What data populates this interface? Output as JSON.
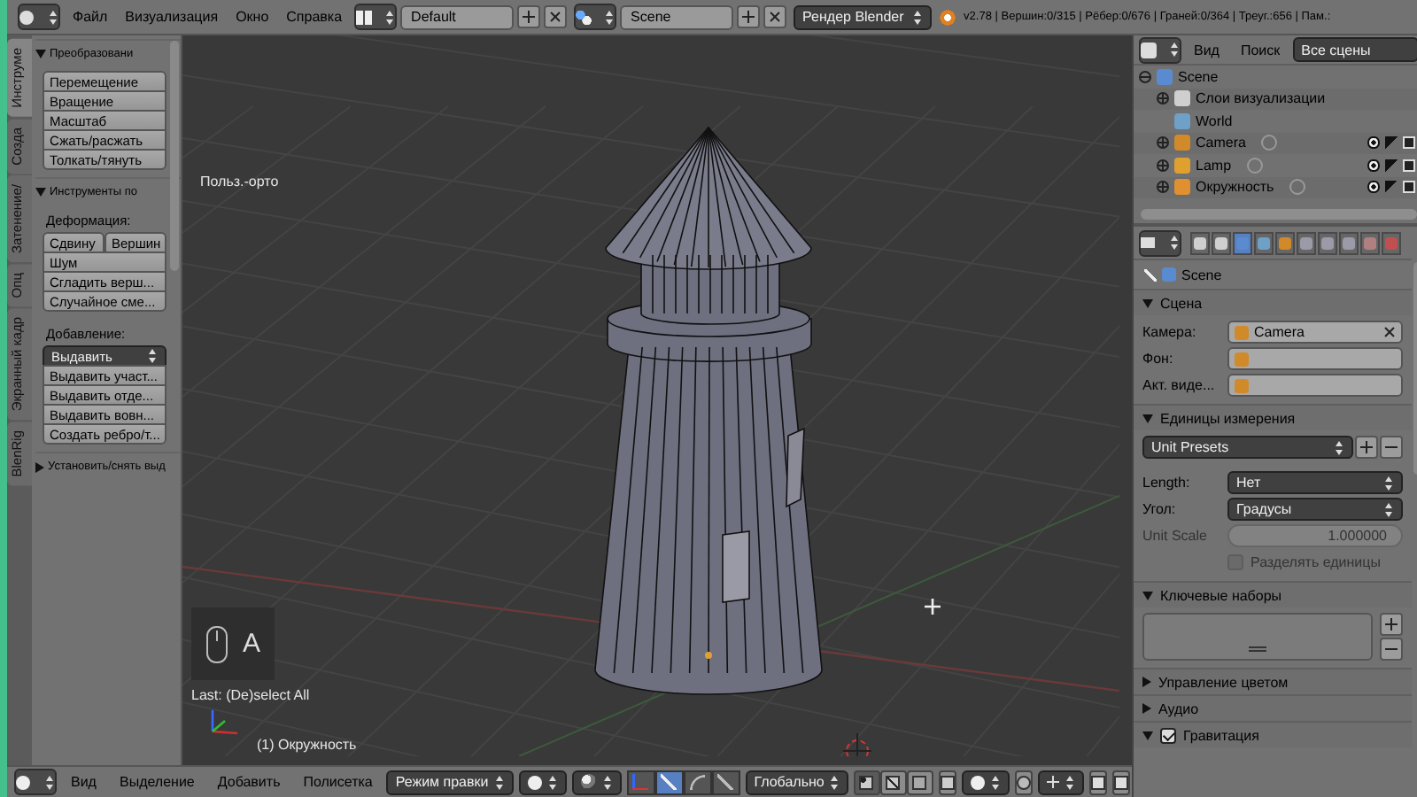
{
  "header": {
    "menus": [
      "Файл",
      "Визуализация",
      "Окно",
      "Справка"
    ],
    "layout": "Default",
    "scene": "Scene",
    "engine": "Рендер Blender",
    "stats": "v2.78 | Вершин:0/315 | Рёбер:0/676 | Граней:0/364 | Треуг.:656 | Пам.:"
  },
  "tool_tabs": [
    {
      "label": "Инструме",
      "selected": true
    },
    {
      "label": "Созда",
      "selected": false
    },
    {
      "label": "Затенение/",
      "selected": false
    },
    {
      "label": "Опц",
      "selected": false
    },
    {
      "label": "Экранный кадр",
      "selected": false
    },
    {
      "label": "BlenRig",
      "selected": false
    }
  ],
  "tool_panels": [
    {
      "title": "Преобразовани",
      "expanded": true,
      "groups": [
        {
          "rows": [
            [
              {
                "label": "Перемещение",
                "kind": "button"
              }
            ],
            [
              {
                "label": "Вращение",
                "kind": "button"
              }
            ],
            [
              {
                "label": "Масштаб",
                "kind": "button"
              }
            ],
            [
              {
                "label": "Сжать/расжать",
                "kind": "button"
              }
            ],
            [
              {
                "label": "Толкать/тянуть",
                "kind": "button"
              }
            ]
          ]
        }
      ]
    },
    {
      "title": "Инструменты по",
      "expanded": true,
      "groups": [
        {
          "label": "Деформация:",
          "rows": [
            [
              {
                "label": "Сдвину",
                "kind": "button"
              },
              {
                "label": "Вершин",
                "kind": "button"
              }
            ],
            [
              {
                "label": "Шум",
                "kind": "button"
              }
            ],
            [
              {
                "label": "Сгладить верш...",
                "kind": "button"
              }
            ],
            [
              {
                "label": "Случайное сме...",
                "kind": "button"
              }
            ]
          ]
        },
        {
          "label": "Добавление:",
          "rows": [
            [
              {
                "label": "Выдавить",
                "kind": "dropdown"
              }
            ],
            [
              {
                "label": "Выдавить участ...",
                "kind": "button"
              }
            ],
            [
              {
                "label": "Выдавить отде...",
                "kind": "button"
              }
            ],
            [
              {
                "label": "Выдавить вовн...",
                "kind": "button"
              }
            ],
            [
              {
                "label": "Создать ребро/т...",
                "kind": "button"
              }
            ]
          ]
        }
      ]
    },
    {
      "title": "Установить/снять выд",
      "expanded": false
    }
  ],
  "viewport": {
    "view_name": "Польз.-орто",
    "key": "A",
    "last_operator": "Last: (De)select All",
    "object": "(1) Окружность"
  },
  "footer": {
    "menus": [
      "Вид",
      "Выделение",
      "Добавить",
      "Полисетка"
    ],
    "mode": "Режим правки",
    "manipulators": [
      {
        "kind": "axes",
        "selected": false
      },
      {
        "kind": "translate",
        "selected": true
      },
      {
        "kind": "rotate",
        "selected": false
      },
      {
        "kind": "scale",
        "selected": false
      }
    ],
    "orientation": "Глобально",
    "select_modes": [
      {
        "kind": "vertex",
        "selected": true
      },
      {
        "kind": "edge",
        "selected": false
      },
      {
        "kind": "face",
        "selected": false
      }
    ]
  },
  "outliner": {
    "menus": [
      "Вид",
      "Поиск"
    ],
    "filter": "Все сцены",
    "tree": [
      {
        "label": "Scene",
        "kind": "scene",
        "expanded": true,
        "children": [
          {
            "label": "Слои визуализации",
            "kind": "layers",
            "expanded": false
          },
          {
            "label": "World",
            "kind": "world"
          },
          {
            "label": "Camera",
            "kind": "camera",
            "expanded": false
          },
          {
            "label": "Lamp",
            "kind": "lamp",
            "expanded": false
          },
          {
            "label": "Окружность",
            "kind": "mesh",
            "expanded": false
          }
        ]
      }
    ]
  },
  "properties": {
    "tabs": [
      {
        "kind": "render",
        "selected": false
      },
      {
        "kind": "layers",
        "selected": false
      },
      {
        "kind": "scene",
        "selected": true
      },
      {
        "kind": "world",
        "selected": false
      },
      {
        "kind": "object",
        "selected": false
      },
      {
        "kind": "constraints",
        "selected": false
      },
      {
        "kind": "modifiers",
        "selected": false
      },
      {
        "kind": "data",
        "selected": false
      },
      {
        "kind": "material",
        "selected": false
      },
      {
        "kind": "texture",
        "selected": false
      }
    ],
    "context": "Scene",
    "panels": [
      {
        "title": "Сцена",
        "expanded": true,
        "rows": [
          {
            "kind": "id_field",
            "label": "Камера:",
            "value": "Camera"
          },
          {
            "kind": "id_field",
            "label": "Фон:"
          },
          {
            "kind": "id_field",
            "label": "Акт. виде..."
          }
        ]
      },
      {
        "title": "Единицы измерения",
        "expanded": true,
        "rows": [
          {
            "kind": "preset",
            "value": "Unit Presets"
          },
          {
            "kind": "dropdown",
            "label": "Length:",
            "value": "Нет"
          },
          {
            "kind": "dropdown",
            "label": "Угол:",
            "value": "Градусы"
          },
          {
            "kind": "number",
            "label": "Unit Scale",
            "value": "1.000000",
            "disabled": true
          },
          {
            "kind": "checkbox",
            "label": "Разделять единицы",
            "checked": false,
            "disabled": true
          }
        ]
      },
      {
        "title": "Ключевые наборы",
        "expanded": true,
        "rows": [
          {
            "kind": "list"
          }
        ]
      },
      {
        "title": "Управление цветом",
        "expanded": false
      },
      {
        "title": "Аудио",
        "expanded": false
      },
      {
        "title": "Гравитация",
        "expanded": true,
        "checked": true
      }
    ]
  }
}
